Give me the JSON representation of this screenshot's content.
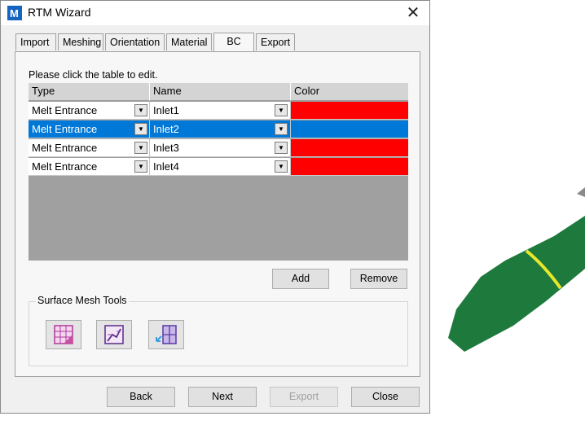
{
  "window": {
    "title": "RTM Wizard",
    "app_icon": "M",
    "close_glyph": "✕"
  },
  "tabs": [
    {
      "label": "Import",
      "active": false
    },
    {
      "label": "Meshing",
      "active": false
    },
    {
      "label": "Orientation",
      "active": false
    },
    {
      "label": "Material",
      "active": false
    },
    {
      "label": "BC",
      "active": true
    },
    {
      "label": "Export",
      "active": false
    }
  ],
  "bc": {
    "instruction": "Please click the table to edit.",
    "columns": [
      "Type",
      "Name",
      "Color"
    ],
    "rows": [
      {
        "type": "Melt Entrance",
        "name": "Inlet1",
        "color": "#ff0000",
        "selected": false
      },
      {
        "type": "Melt Entrance",
        "name": "Inlet2",
        "color": "#ff0000",
        "selected": true
      },
      {
        "type": "Melt Entrance",
        "name": "Inlet3",
        "color": "#ff0000",
        "selected": false
      },
      {
        "type": "Melt Entrance",
        "name": "Inlet4",
        "color": "#ff0000",
        "selected": false
      }
    ],
    "add_label": "Add",
    "remove_label": "Remove",
    "surface_mesh_tools_label": "Surface Mesh Tools",
    "tools": [
      "mesh-3d-icon",
      "mesh-edit-icon",
      "mesh-split-icon"
    ]
  },
  "footer": {
    "back": "Back",
    "next": "Next",
    "export": "Export",
    "close": "Close"
  },
  "colors": {
    "selection": "#0078d7",
    "inlet": "#ff0000",
    "model_green": "#1d7a3c",
    "model_line": "#e8e82a"
  }
}
